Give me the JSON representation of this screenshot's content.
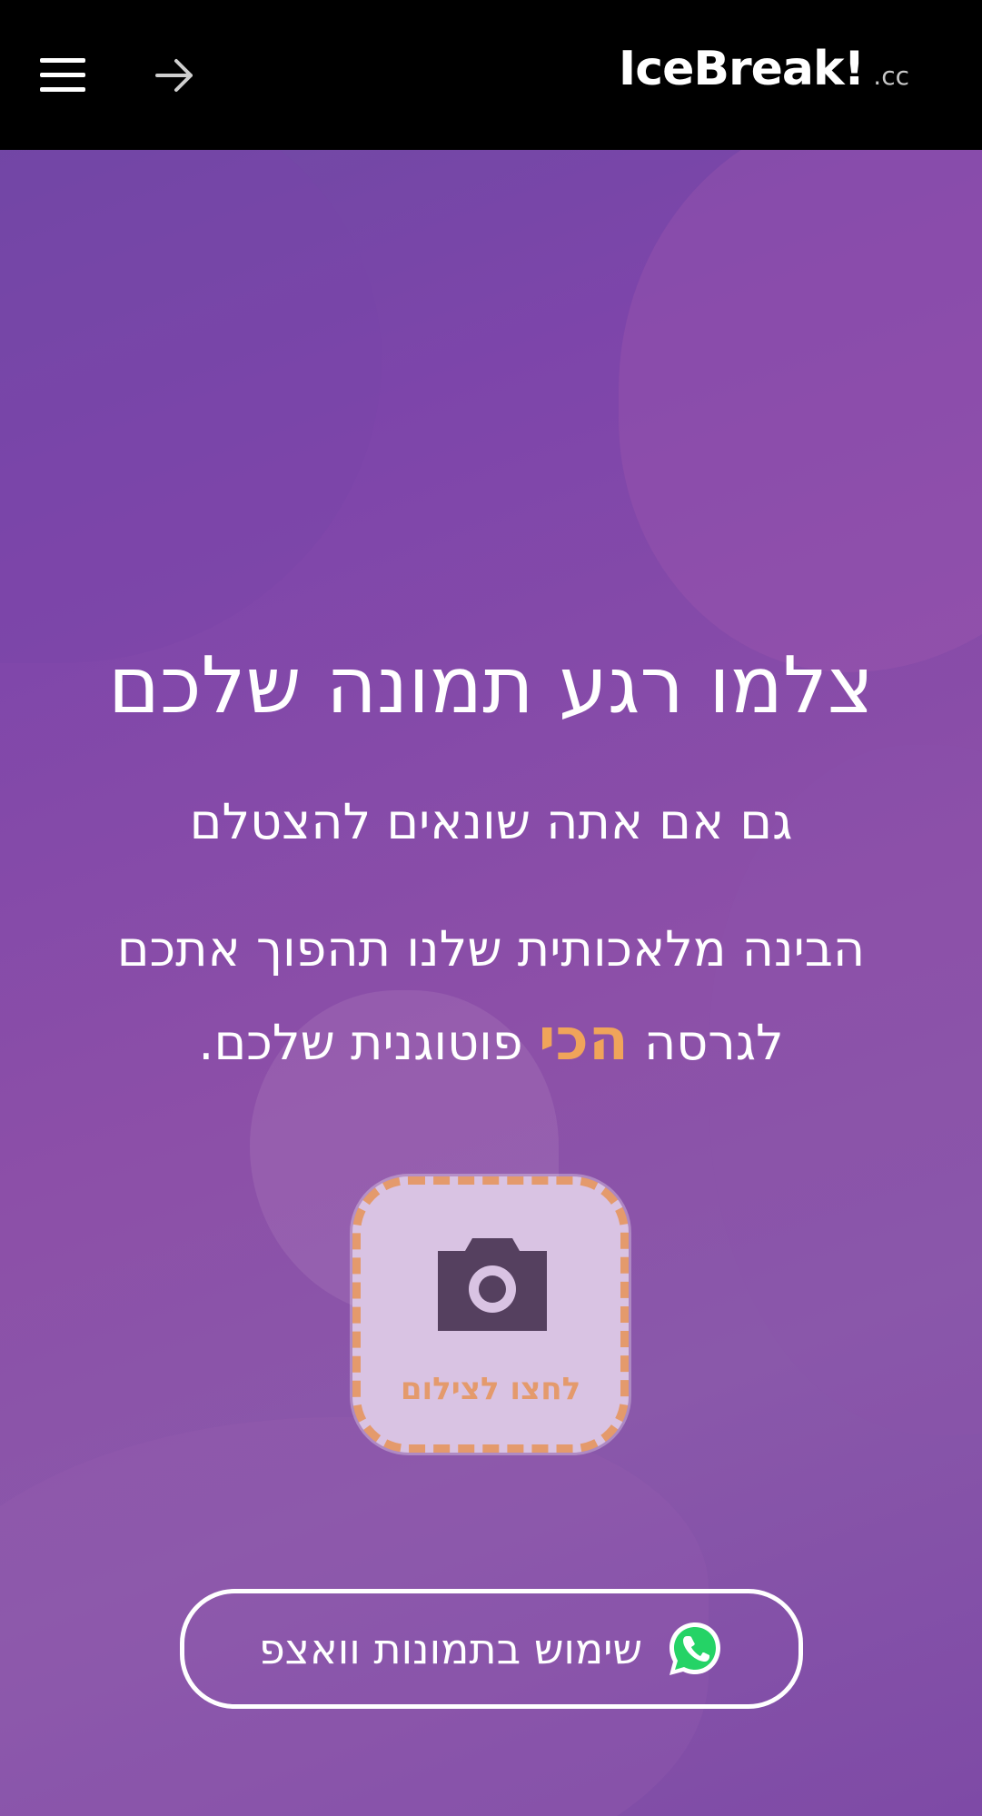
{
  "header": {
    "logo_main": "IceBreak!",
    "logo_suffix": ".cc",
    "menu_icon": "hamburger-menu-icon",
    "forward_icon": "arrow-right-icon"
  },
  "main": {
    "headline": "צלמו רגע תמונה שלכם",
    "subtitle_line1": "גם אם אתה שונאים להצטלם",
    "subtitle_line2_part1": "הבינה מלאכותית שלנו תהפוך אתכם לגרסה",
    "subtitle_highlight": "הכי",
    "subtitle_line2_part2": "פוטוגנית שלכם."
  },
  "camera_button": {
    "label": "לחצו לצילום",
    "icon": "camera-icon"
  },
  "whatsapp_button": {
    "label": "שימוש בתמונות וואצפ",
    "icon": "whatsapp-icon"
  },
  "colors": {
    "header_bg": "#000000",
    "accent_orange": "#f0a45a",
    "camera_bg": "#d9c3e3",
    "camera_border": "#e49a6c",
    "whatsapp_green": "#25d366"
  }
}
